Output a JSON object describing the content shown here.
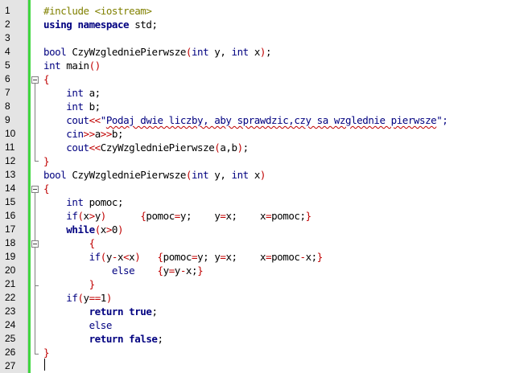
{
  "editor": {
    "lines": [
      {
        "num": "1",
        "tokens": [
          {
            "t": "#include <iostream>",
            "c": "pp"
          }
        ]
      },
      {
        "num": "2",
        "tokens": [
          {
            "t": "using namespace",
            "c": "kw"
          },
          {
            "t": " std;",
            "c": "fn"
          }
        ]
      },
      {
        "num": "3",
        "tokens": []
      },
      {
        "num": "4",
        "tokens": [
          {
            "t": "bool",
            "c": "ty"
          },
          {
            "t": " CzyWzgledniePierwsze",
            "c": "fn"
          },
          {
            "t": "(",
            "c": "op"
          },
          {
            "t": "int",
            "c": "ty"
          },
          {
            "t": " y, ",
            "c": "fn"
          },
          {
            "t": "int",
            "c": "ty"
          },
          {
            "t": " x",
            "c": "fn"
          },
          {
            "t": ")",
            "c": "op"
          },
          {
            "t": ";",
            "c": "fn"
          }
        ]
      },
      {
        "num": "5",
        "tokens": [
          {
            "t": "int",
            "c": "ty"
          },
          {
            "t": " main",
            "c": "fn"
          },
          {
            "t": "()",
            "c": "op"
          }
        ]
      },
      {
        "num": "6",
        "tokens": [
          {
            "t": "{",
            "c": "op"
          }
        ]
      },
      {
        "num": "7",
        "tokens": [
          {
            "t": "    int",
            "c": "ty"
          },
          {
            "t": " a;",
            "c": "fn"
          }
        ]
      },
      {
        "num": "8",
        "tokens": [
          {
            "t": "    int",
            "c": "ty"
          },
          {
            "t": " b;",
            "c": "fn"
          }
        ]
      },
      {
        "num": "9",
        "tokens": [
          {
            "t": "    cout",
            "c": "ty"
          },
          {
            "t": "<<",
            "c": "op"
          },
          {
            "t": "\"",
            "c": "str"
          },
          {
            "t": "Podaj dwie liczby, aby sprawdzic,czy sa wzglednie pierwsze",
            "c": "str squig"
          },
          {
            "t": "\";",
            "c": "str"
          }
        ]
      },
      {
        "num": "10",
        "tokens": [
          {
            "t": "    cin",
            "c": "ty"
          },
          {
            "t": ">>",
            "c": "op"
          },
          {
            "t": "a",
            "c": "fn"
          },
          {
            "t": ">>",
            "c": "op"
          },
          {
            "t": "b;",
            "c": "fn"
          }
        ]
      },
      {
        "num": "11",
        "tokens": [
          {
            "t": "    cout",
            "c": "ty"
          },
          {
            "t": "<<",
            "c": "op"
          },
          {
            "t": "CzyWzgledniePierwsze",
            "c": "fn"
          },
          {
            "t": "(",
            "c": "op"
          },
          {
            "t": "a,b",
            "c": "fn"
          },
          {
            "t": ")",
            "c": "op"
          },
          {
            "t": ";",
            "c": "fn"
          }
        ]
      },
      {
        "num": "12",
        "tokens": [
          {
            "t": "}",
            "c": "op"
          }
        ]
      },
      {
        "num": "13",
        "tokens": [
          {
            "t": "bool",
            "c": "ty"
          },
          {
            "t": " CzyWzgledniePierwsze",
            "c": "fn"
          },
          {
            "t": "(",
            "c": "op"
          },
          {
            "t": "int",
            "c": "ty"
          },
          {
            "t": " y, ",
            "c": "fn"
          },
          {
            "t": "int",
            "c": "ty"
          },
          {
            "t": " x",
            "c": "fn"
          },
          {
            "t": ")",
            "c": "op"
          }
        ]
      },
      {
        "num": "14",
        "tokens": [
          {
            "t": "{",
            "c": "op"
          }
        ]
      },
      {
        "num": "15",
        "tokens": [
          {
            "t": "    int",
            "c": "ty"
          },
          {
            "t": " pomoc;",
            "c": "fn"
          }
        ]
      },
      {
        "num": "16",
        "tokens": [
          {
            "t": "    if",
            "c": "ty"
          },
          {
            "t": "(",
            "c": "op"
          },
          {
            "t": "x",
            "c": "fn"
          },
          {
            "t": ">",
            "c": "op"
          },
          {
            "t": "y",
            "c": "fn"
          },
          {
            "t": ")",
            "c": "op"
          },
          {
            "t": "      ",
            "c": "fn"
          },
          {
            "t": "{",
            "c": "op"
          },
          {
            "t": "pomoc",
            "c": "fn"
          },
          {
            "t": "=",
            "c": "op"
          },
          {
            "t": "y;    y",
            "c": "fn"
          },
          {
            "t": "=",
            "c": "op"
          },
          {
            "t": "x;    x",
            "c": "fn"
          },
          {
            "t": "=",
            "c": "op"
          },
          {
            "t": "pomoc;",
            "c": "fn"
          },
          {
            "t": "}",
            "c": "op"
          }
        ]
      },
      {
        "num": "17",
        "tokens": [
          {
            "t": "    while",
            "c": "kw"
          },
          {
            "t": "(",
            "c": "op"
          },
          {
            "t": "x",
            "c": "fn"
          },
          {
            "t": ">",
            "c": "op"
          },
          {
            "t": "0",
            "c": "fn"
          },
          {
            "t": ")",
            "c": "op"
          }
        ]
      },
      {
        "num": "18",
        "tokens": [
          {
            "t": "        {",
            "c": "op"
          }
        ]
      },
      {
        "num": "19",
        "tokens": [
          {
            "t": "        if",
            "c": "ty"
          },
          {
            "t": "(",
            "c": "op"
          },
          {
            "t": "y",
            "c": "fn"
          },
          {
            "t": "-",
            "c": "op"
          },
          {
            "t": "x",
            "c": "fn"
          },
          {
            "t": "<",
            "c": "op"
          },
          {
            "t": "x",
            "c": "fn"
          },
          {
            "t": ")",
            "c": "op"
          },
          {
            "t": "   ",
            "c": "fn"
          },
          {
            "t": "{",
            "c": "op"
          },
          {
            "t": "pomoc",
            "c": "fn"
          },
          {
            "t": "=",
            "c": "op"
          },
          {
            "t": "y; y",
            "c": "fn"
          },
          {
            "t": "=",
            "c": "op"
          },
          {
            "t": "x;    x",
            "c": "fn"
          },
          {
            "t": "=",
            "c": "op"
          },
          {
            "t": "pomoc",
            "c": "fn"
          },
          {
            "t": "-",
            "c": "op"
          },
          {
            "t": "x;",
            "c": "fn"
          },
          {
            "t": "}",
            "c": "op"
          }
        ]
      },
      {
        "num": "20",
        "tokens": [
          {
            "t": "            else",
            "c": "ty"
          },
          {
            "t": "    ",
            "c": "fn"
          },
          {
            "t": "{",
            "c": "op"
          },
          {
            "t": "y",
            "c": "fn"
          },
          {
            "t": "=",
            "c": "op"
          },
          {
            "t": "y",
            "c": "fn"
          },
          {
            "t": "-",
            "c": "op"
          },
          {
            "t": "x;",
            "c": "fn"
          },
          {
            "t": "}",
            "c": "op"
          }
        ]
      },
      {
        "num": "21",
        "tokens": [
          {
            "t": "        }",
            "c": "op"
          }
        ]
      },
      {
        "num": "22",
        "tokens": [
          {
            "t": "    if",
            "c": "ty"
          },
          {
            "t": "(",
            "c": "op"
          },
          {
            "t": "y",
            "c": "fn"
          },
          {
            "t": "==",
            "c": "op"
          },
          {
            "t": "1",
            "c": "fn"
          },
          {
            "t": ")",
            "c": "op"
          }
        ]
      },
      {
        "num": "23",
        "tokens": [
          {
            "t": "        return true",
            "c": "kw"
          },
          {
            "t": ";",
            "c": "fn"
          }
        ]
      },
      {
        "num": "24",
        "tokens": [
          {
            "t": "        else",
            "c": "ty"
          }
        ]
      },
      {
        "num": "25",
        "tokens": [
          {
            "t": "        return false",
            "c": "kw"
          },
          {
            "t": ";",
            "c": "fn"
          }
        ]
      },
      {
        "num": "26",
        "tokens": [
          {
            "t": "}",
            "c": "op"
          }
        ]
      },
      {
        "num": "27",
        "tokens": []
      }
    ]
  }
}
